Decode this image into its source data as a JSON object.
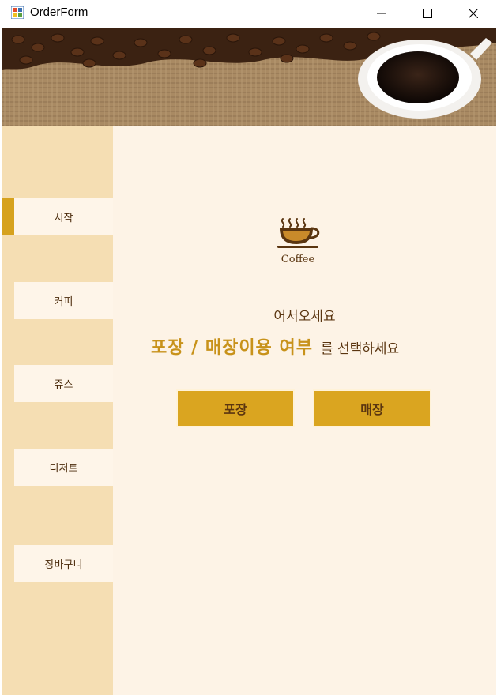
{
  "window": {
    "title": "OrderForm",
    "controls": {
      "minimize": "minimize-icon",
      "maximize": "maximize-icon",
      "close": "close-icon"
    }
  },
  "sidebar": {
    "items": [
      {
        "label": "시작",
        "active": true
      },
      {
        "label": "커피",
        "active": false
      },
      {
        "label": "쥬스",
        "active": false
      },
      {
        "label": "디저트",
        "active": false
      },
      {
        "label": "장바구니",
        "active": false
      }
    ]
  },
  "main": {
    "logo_text": "Coffee",
    "welcome": "어서오세요",
    "question_strong": "포장 / 매장이용 여부",
    "question_rest": "를 선택하세요",
    "buttons": {
      "takeout": "포장",
      "dine_in": "매장"
    }
  },
  "colors": {
    "accent": "#daa520",
    "sidebar_bg": "#f5deb3",
    "content_bg": "#fdf3e6",
    "text_brown": "#5a3510"
  }
}
